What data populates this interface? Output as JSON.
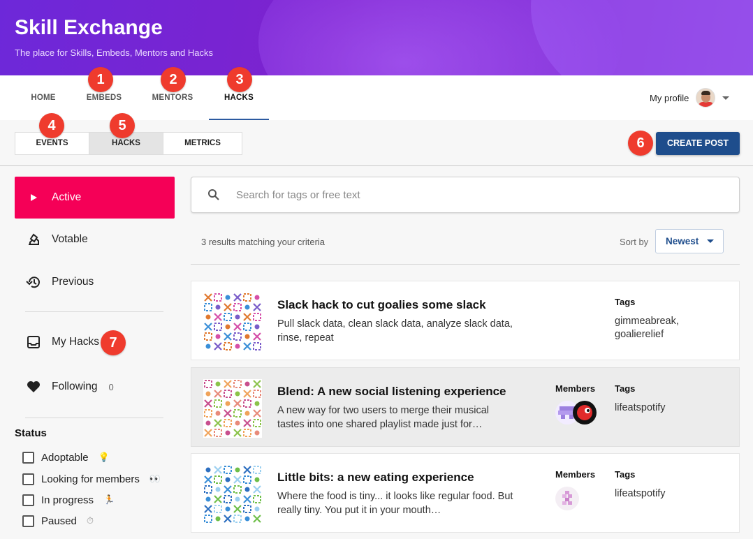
{
  "header": {
    "title": "Skill Exchange",
    "subtitle": "The place for Skills, Embeds, Mentors and Hacks"
  },
  "nav": {
    "tabs": [
      {
        "label": "HOME"
      },
      {
        "label": "EMBEDS"
      },
      {
        "label": "MENTORS"
      },
      {
        "label": "HACKS"
      }
    ],
    "active": "HACKS",
    "profile_label": "My profile"
  },
  "badges": [
    "1",
    "2",
    "3",
    "4",
    "5",
    "6",
    "7"
  ],
  "subnav": {
    "tabs": [
      {
        "label": "EVENTS"
      },
      {
        "label": "HACKS"
      },
      {
        "label": "METRICS"
      }
    ],
    "active": "HACKS",
    "create_label": "CREATE POST"
  },
  "sidebar": {
    "items": [
      {
        "label": "Active",
        "icon": "play-icon"
      },
      {
        "label": "Votable",
        "icon": "ballot-icon"
      },
      {
        "label": "Previous",
        "icon": "history-icon"
      },
      {
        "label": "My Hacks",
        "icon": "inbox-icon"
      },
      {
        "label": "Following",
        "icon": "heart-icon",
        "count": "0"
      }
    ],
    "status_title": "Status",
    "statuses": [
      {
        "label": "Adoptable",
        "emoji": "💡"
      },
      {
        "label": "Looking for members",
        "emoji": "👀"
      },
      {
        "label": "In progress",
        "emoji": "🏃"
      },
      {
        "label": "Paused",
        "emoji": "⏱"
      }
    ]
  },
  "search": {
    "placeholder": "Search for tags or free text"
  },
  "results_text": "3 results matching your criteria",
  "sort": {
    "label": "Sort by",
    "value": "Newest"
  },
  "columns": {
    "members": "Members",
    "tags": "Tags"
  },
  "posts": [
    {
      "title": "Slack hack to cut goalies some slack",
      "desc": "Pull slack data, clean slack data, analyze slack data, rinse, repeat",
      "tags": "gimmeabreak, goalierelief",
      "palette": [
        "#e0792f",
        "#d64fa8",
        "#3a8fd8",
        "#7a5cc9"
      ]
    },
    {
      "title": "Blend: A new social listening experience",
      "desc": "A new way for two users to merge their musical tastes into one shared playlist made just for…",
      "tags": "lifeatspotify",
      "palette": [
        "#e88a7a",
        "#c84f8e",
        "#8bc34a",
        "#f0a35a"
      ]
    },
    {
      "title": "Little bits: a new eating experience",
      "desc": "Where the food is tiny... it looks like regular food. But really tiny. You put it in your mouth…",
      "tags": "lifeatspotify",
      "palette": [
        "#3a8fd8",
        "#6fbf4a",
        "#2d6fc0",
        "#9bd0f0"
      ]
    }
  ],
  "colors": {
    "accent": "#f50057",
    "primary": "#1e4d8c",
    "badge": "#ef3b2d"
  }
}
